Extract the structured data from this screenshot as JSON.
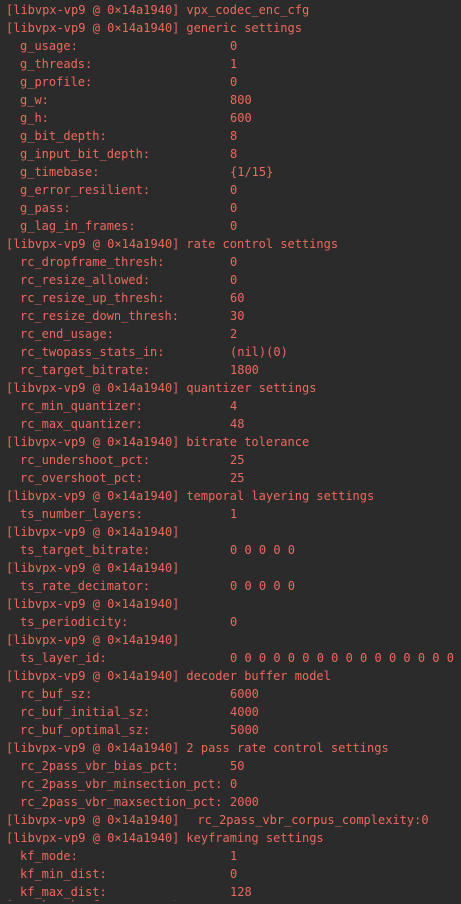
{
  "prefix": "[libvpx-vp9 @ 0×14a1940]",
  "lines": [
    {
      "kind": "header",
      "text": "vpx_codec_enc_cfg"
    },
    {
      "kind": "header",
      "text": "generic settings"
    },
    {
      "kind": "kv",
      "key": "g_usage:",
      "value": "0"
    },
    {
      "kind": "kv",
      "key": "g_threads:",
      "value": "1"
    },
    {
      "kind": "kv",
      "key": "g_profile:",
      "value": "0"
    },
    {
      "kind": "kv",
      "key": "g_w:",
      "value": "800"
    },
    {
      "kind": "kv",
      "key": "g_h:",
      "value": "600"
    },
    {
      "kind": "kv",
      "key": "g_bit_depth:",
      "value": "8"
    },
    {
      "kind": "kv",
      "key": "g_input_bit_depth:",
      "value": "8"
    },
    {
      "kind": "kv",
      "key": "g_timebase:",
      "value": "{1/15}"
    },
    {
      "kind": "kv",
      "key": "g_error_resilient:",
      "value": "0"
    },
    {
      "kind": "kv",
      "key": "g_pass:",
      "value": "0"
    },
    {
      "kind": "kv",
      "key": "g_lag_in_frames:",
      "value": "0"
    },
    {
      "kind": "header",
      "text": "rate control settings"
    },
    {
      "kind": "kv",
      "key": "rc_dropframe_thresh:",
      "value": "0"
    },
    {
      "kind": "kv",
      "key": "rc_resize_allowed:",
      "value": "0"
    },
    {
      "kind": "kv",
      "key": "rc_resize_up_thresh:",
      "value": "60"
    },
    {
      "kind": "kv",
      "key": "rc_resize_down_thresh:",
      "value": "30"
    },
    {
      "kind": "kv",
      "key": "rc_end_usage:",
      "value": "2"
    },
    {
      "kind": "kv",
      "key": "rc_twopass_stats_in:",
      "value": "(nil)(0)"
    },
    {
      "kind": "kv",
      "key": "rc_target_bitrate:",
      "value": "1800"
    },
    {
      "kind": "header",
      "text": "quantizer settings"
    },
    {
      "kind": "kv",
      "key": "rc_min_quantizer:",
      "value": "4"
    },
    {
      "kind": "kv",
      "key": "rc_max_quantizer:",
      "value": "48"
    },
    {
      "kind": "header",
      "text": "bitrate tolerance"
    },
    {
      "kind": "kv",
      "key": "rc_undershoot_pct:",
      "value": "25"
    },
    {
      "kind": "kv",
      "key": "rc_overshoot_pct:",
      "value": "25"
    },
    {
      "kind": "header",
      "text": "temporal layering settings"
    },
    {
      "kind": "kv",
      "key": "ts_number_layers:",
      "value": "1"
    },
    {
      "kind": "header",
      "text": ""
    },
    {
      "kind": "kv",
      "key": "ts_target_bitrate:",
      "value": "0 0 0 0 0"
    },
    {
      "kind": "header",
      "text": ""
    },
    {
      "kind": "kv",
      "key": "ts_rate_decimator:",
      "value": "0 0 0 0 0"
    },
    {
      "kind": "header",
      "text": ""
    },
    {
      "kind": "kv",
      "key": "ts_periodicity:",
      "value": "0"
    },
    {
      "kind": "header",
      "text": ""
    },
    {
      "kind": "kv",
      "key": "ts_layer_id:",
      "value": "0 0 0 0 0 0 0 0 0 0 0 0 0 0 0 0 0 0"
    },
    {
      "kind": "header",
      "text": "decoder buffer model"
    },
    {
      "kind": "kv",
      "key": "rc_buf_sz:",
      "value": "6000"
    },
    {
      "kind": "kv",
      "key": "rc_buf_initial_sz:",
      "value": "4000"
    },
    {
      "kind": "kv",
      "key": "rc_buf_optimal_sz:",
      "value": "5000"
    },
    {
      "kind": "header",
      "text": "2 pass rate control settings"
    },
    {
      "kind": "kv",
      "key": "rc_2pass_vbr_bias_pct:",
      "value": "50"
    },
    {
      "kind": "kv",
      "key": "rc_2pass_vbr_minsection_pct:",
      "value": "0"
    },
    {
      "kind": "kv",
      "key": "rc_2pass_vbr_maxsection_pct:",
      "value": "2000"
    },
    {
      "kind": "header-inline",
      "text": "rc_2pass_vbr_corpus_complexity:0"
    },
    {
      "kind": "header",
      "text": "keyframing settings"
    },
    {
      "kind": "kv",
      "key": "kf_mode:",
      "value": "1"
    },
    {
      "kind": "kv",
      "key": "kf_min_dist:",
      "value": "0"
    },
    {
      "kind": "kv",
      "key": "kf_max_dist:",
      "value": "128"
    }
  ],
  "cutoff_text": "[libvpx-vp9 @ 0×14a1940]"
}
